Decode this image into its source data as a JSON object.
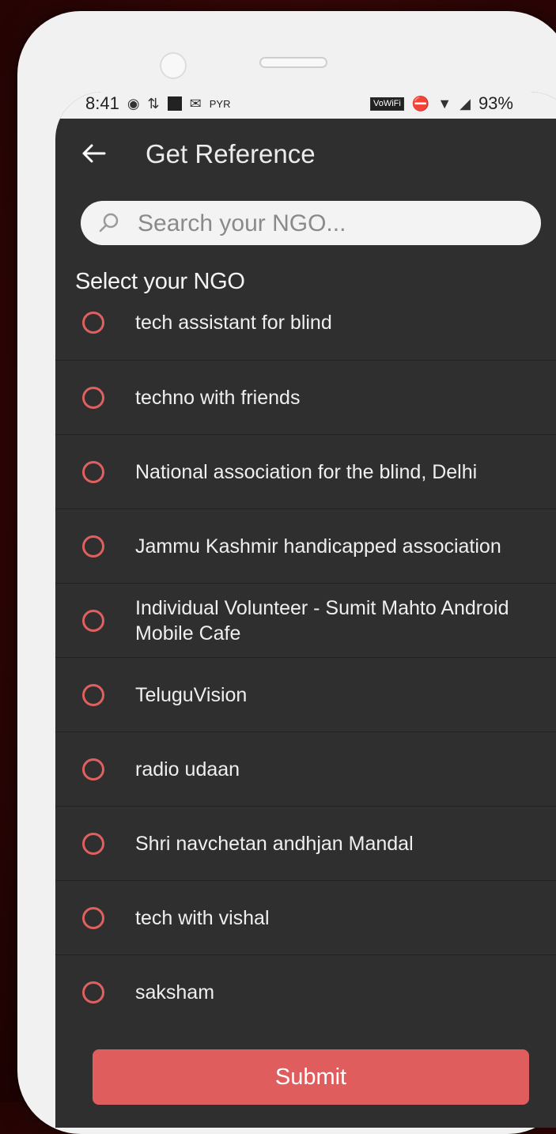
{
  "status_bar": {
    "time": "8:41",
    "carrier_tag": "PYR",
    "wifi_tag": "VoWiFi",
    "battery": "93%"
  },
  "app_bar": {
    "title": "Get Reference"
  },
  "search": {
    "placeholder": "Search your NGO..."
  },
  "section_label": "Select your NGO",
  "ngos": [
    "tech assistant for blind",
    "techno with friends",
    "National association for the blind, Delhi",
    "Jammu Kashmir handicapped association",
    "Individual Volunteer - Sumit Mahto Android Mobile Cafe",
    "TeluguVision",
    "radio udaan",
    "Shri navchetan andhjan Mandal",
    "tech with vishal",
    "saksham"
  ],
  "submit_label": "Submit",
  "colors": {
    "accent": "#e05d5d",
    "background": "#2f2f2f"
  }
}
